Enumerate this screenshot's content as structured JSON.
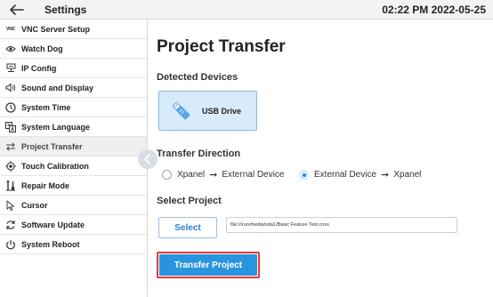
{
  "header": {
    "back_icon": "arrow-left-icon",
    "title": "Settings",
    "datetime": "02:22 PM 2022-05-25"
  },
  "sidebar": {
    "items": [
      {
        "label": "VNC Server Setup",
        "icon": "vnc-icon",
        "icon_text": "VNC"
      },
      {
        "label": "Watch Dog",
        "icon": "eye-icon"
      },
      {
        "label": "IP Config",
        "icon": "network-icon"
      },
      {
        "label": "Sound and Display",
        "icon": "speaker-icon"
      },
      {
        "label": "System Time",
        "icon": "clock-icon"
      },
      {
        "label": "System Language",
        "icon": "language-icon"
      },
      {
        "label": "Project Transfer",
        "icon": "transfer-icon",
        "active": true
      },
      {
        "label": "Touch Calibration",
        "icon": "target-icon"
      },
      {
        "label": "Repair Mode",
        "icon": "tools-icon"
      },
      {
        "label": "Cursor",
        "icon": "cursor-icon"
      },
      {
        "label": "Software Update",
        "icon": "refresh-icon"
      },
      {
        "label": "System Reboot",
        "icon": "power-icon"
      }
    ]
  },
  "main": {
    "title": "Project Transfer",
    "detected_label": "Detected Devices",
    "device": {
      "label": "USB Drive",
      "icon": "usb-drive-icon"
    },
    "direction_label": "Transfer Direction",
    "direction_options": [
      {
        "label": "Xpanel",
        "arrow": "➞",
        "target": "External Device",
        "selected": false
      },
      {
        "label": "External Device",
        "arrow": "➞",
        "target": "Xpanel",
        "selected": true
      }
    ],
    "select_label": "Select Project",
    "select_button": "Select",
    "path_value": "file:///run/media/sda1/Basic Feature Test.cnvs",
    "transfer_button": "Transfer Project"
  },
  "colors": {
    "accent": "#2a95de",
    "highlight_outline": "#e53935",
    "device_card": "#d8ebfa",
    "radio_selected": "#1e88e5"
  }
}
